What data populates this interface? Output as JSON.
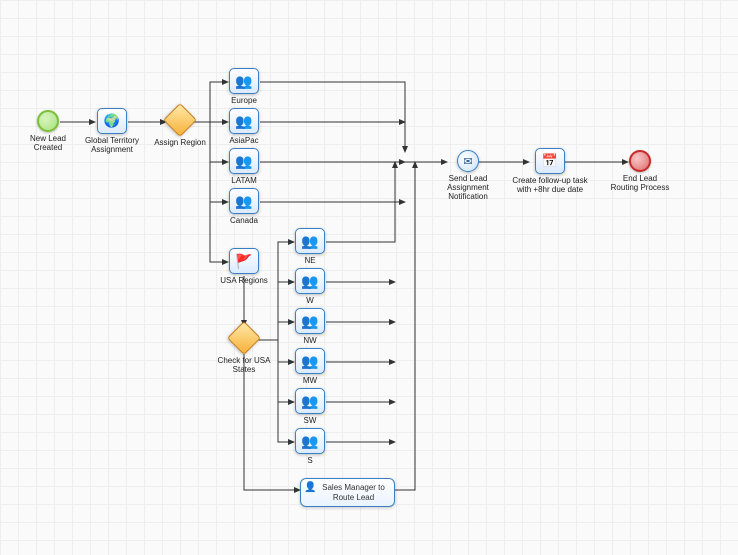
{
  "nodes": {
    "start": {
      "label": "New Lead Created"
    },
    "globalTerritory": {
      "label": "Global Territory Assignment"
    },
    "assignRegion": {
      "label": "Assign Region"
    },
    "europe": {
      "label": "Europe"
    },
    "asiapac": {
      "label": "AsiaPac"
    },
    "latam": {
      "label": "LATAM"
    },
    "canada": {
      "label": "Canada"
    },
    "usaRegions": {
      "label": "USA Regions"
    },
    "checkUSA": {
      "label": "Check for USA States"
    },
    "ne": {
      "label": "NE"
    },
    "w": {
      "label": "W"
    },
    "nw": {
      "label": "NW"
    },
    "mw": {
      "label": "MW"
    },
    "sw": {
      "label": "SW"
    },
    "s": {
      "label": "S"
    },
    "salesMgr": {
      "label": "Sales Manager to Route Lead"
    },
    "sendNotif": {
      "label": "Send Lead Assignment Notification"
    },
    "followUp": {
      "label": "Create follow-up task with +8hr due date"
    },
    "end": {
      "label": "End Lead Routing Process"
    }
  },
  "diagram": {
    "type": "BPMN Workflow",
    "startEvent": "New Lead Created",
    "endEvent": "End Lead Routing Process",
    "gateways": [
      "Assign Region",
      "Check for USA States"
    ],
    "regionBranches": [
      "Europe",
      "AsiaPac",
      "LATAM",
      "Canada",
      "USA Regions"
    ],
    "usaStateBranches": [
      "NE",
      "W",
      "NW",
      "MW",
      "SW",
      "S"
    ],
    "subprocess": "Sales Manager to Route Lead",
    "postAssignment": [
      "Send Lead Assignment Notification",
      "Create follow-up task with +8hr due date"
    ]
  }
}
